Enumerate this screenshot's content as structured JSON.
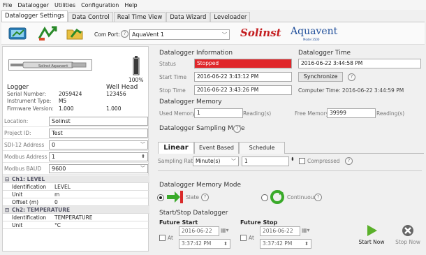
{
  "menu": [
    "File",
    "Datalogger",
    "Utilities",
    "Configuration",
    "Help"
  ],
  "tabs": [
    "Datalogger Settings",
    "Data Control",
    "Real Time View",
    "Data Wizard",
    "Leveloader"
  ],
  "toolbar": {
    "com_port_label": "Com Port:",
    "com_port_value": "AquaVent 1",
    "brand_solinst": "Solinst",
    "brand_aquavent": "Aquavent",
    "brand_model": "Model 3500"
  },
  "left": {
    "battery": "100%",
    "logger_heading": "Logger",
    "wellhead_heading": "Well Head",
    "serial_label": "Serial Number:",
    "serial_value": "2059424",
    "serial_wellhead": "123456",
    "instrument_label": "Instrument Type:",
    "instrument_value": "M5",
    "firmware_label": "Firmware Version:",
    "firmware_value": "1.000",
    "firmware_wellhead": "1.000",
    "location_label": "Location:",
    "location_value": "Solinst",
    "project_label": "Project ID:",
    "project_value": "Test",
    "sdi_label": "SDI-12 Address",
    "sdi_value": "0",
    "modbus_label": "Modbus Address",
    "modbus_value": "1",
    "baud_label": "Modbus BAUD",
    "baud_value": "9600"
  },
  "channels": [
    {
      "heading": "Ch1: LEVEL",
      "rows": [
        [
          "Identification",
          "LEVEL"
        ],
        [
          "Unit",
          "m"
        ],
        [
          "Offset (m)",
          "0"
        ]
      ]
    },
    {
      "heading": "Ch2: TEMPERATURE",
      "rows": [
        [
          "Identification",
          "TEMPERATURE"
        ],
        [
          "Unit",
          "°C"
        ]
      ]
    }
  ],
  "info": {
    "title": "Datalogger Information",
    "status_label": "Status",
    "status_value": "Stopped",
    "start_label": "Start Time",
    "start_value": "2016-06-22 3:43:12 PM",
    "stop_label": "Stop Time",
    "stop_value": "2016-06-22 3:43:26 PM"
  },
  "time": {
    "title": "Datalogger Time",
    "value": "2016-06-22 3:44:58 PM",
    "sync": "Synchronize",
    "computer": "Computer Time: 2016-06-22 3:44:59 PM"
  },
  "memory": {
    "title": "Datalogger Memory",
    "used_label": "Used Memory",
    "used_value": "1",
    "used_unit": "Reading(s)",
    "free_label": "Free Memory",
    "free_value": "39999",
    "free_unit": "Reading(s)"
  },
  "sampling": {
    "title": "Datalogger Sampling Mode",
    "tabs": [
      "Linear",
      "Event Based",
      "Schedule"
    ],
    "rate_label": "Sampling Rate",
    "rate_unit": "Minute(s)",
    "rate_value": "1",
    "compressed": "Compressed"
  },
  "memmode": {
    "title": "Datalogger Memory Mode",
    "slate": "Slate",
    "continuous": "Continuous"
  },
  "startstop": {
    "title": "Start/Stop Datalogger",
    "future_start": "Future Start",
    "future_stop": "Future Stop",
    "at": "At",
    "start_date": "2016-06-22",
    "start_time": "3:37:42 PM",
    "stop_date": "2016-06-22",
    "stop_time": "3:37:42 PM",
    "start_now": "Start Now",
    "stop_now": "Stop Now"
  },
  "colors": {
    "status_red": "#e0262a",
    "brand_red": "#c41e20",
    "accent_blue": "#1f4e9a"
  }
}
